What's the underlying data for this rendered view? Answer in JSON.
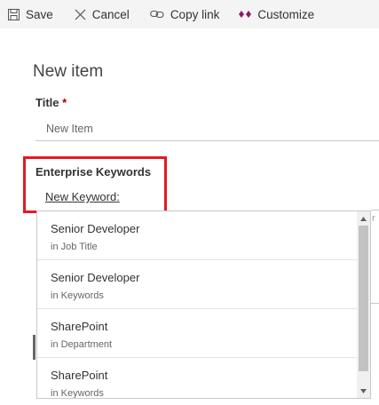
{
  "commandbar": {
    "save_label": "Save",
    "cancel_label": "Cancel",
    "copylink_label": "Copy link",
    "customize_label": "Customize"
  },
  "panel": {
    "title": "New item"
  },
  "form": {
    "title_label": "Title",
    "required_marker": "*",
    "title_value": "New Item",
    "ek_label": "Enterprise Keywords",
    "new_keyword_link": "New Keyword",
    "new_keyword_suffix": ":"
  },
  "dropdown": {
    "items": [
      {
        "name": "Senior Developer",
        "sub": "in Job Title"
      },
      {
        "name": "Senior Developer",
        "sub": "in Keywords"
      },
      {
        "name": "SharePoint",
        "sub": "in Department"
      },
      {
        "name": "SharePoint",
        "sub": "in Keywords"
      }
    ]
  },
  "background": {
    "partial_text": "r"
  },
  "colors": {
    "accent": "#e11b22",
    "customize_icon": "#8a1c6e"
  }
}
